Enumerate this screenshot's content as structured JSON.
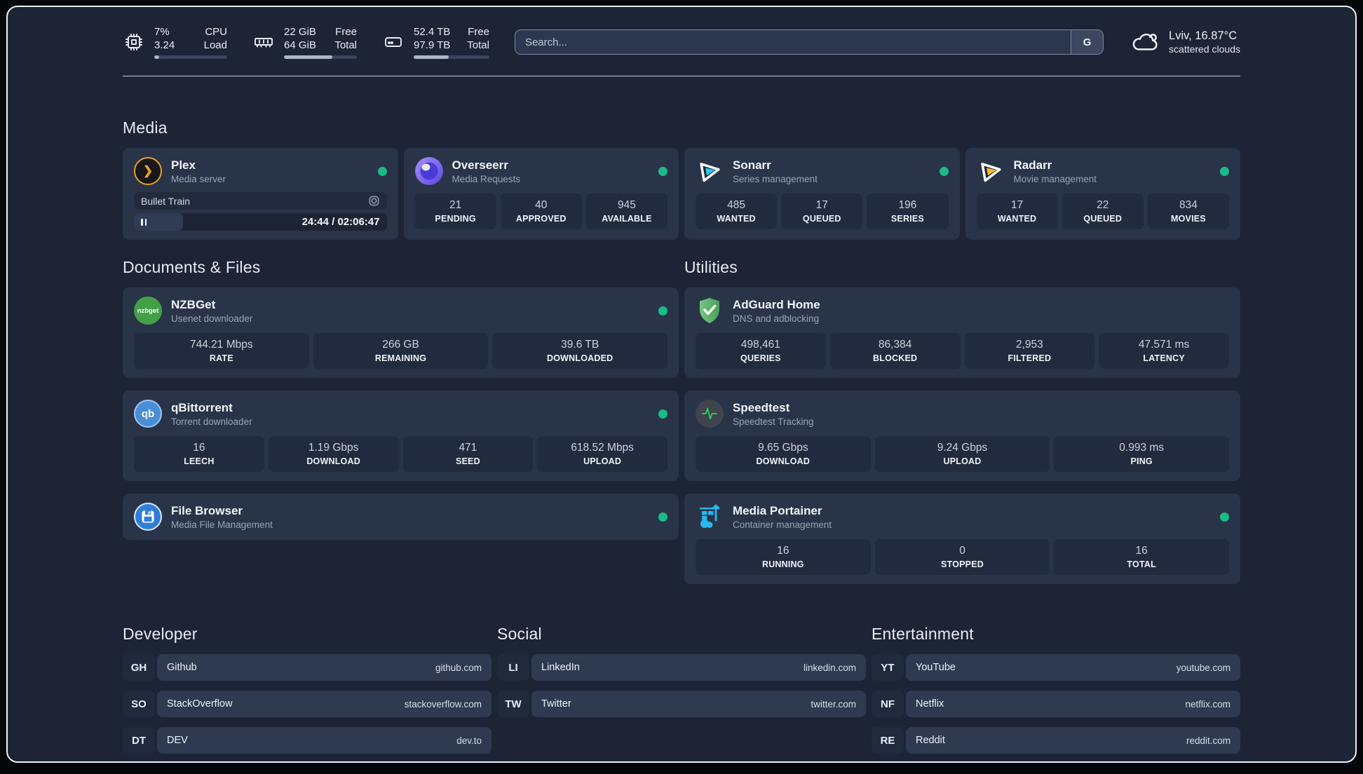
{
  "header": {
    "cpu": {
      "value_top": "7%",
      "value_bottom": "3.24",
      "label_top": "CPU",
      "label_bottom": "Load",
      "progress_pct": 7
    },
    "memory": {
      "value_top": "22 GiB",
      "value_bottom": "64 GiB",
      "label_top": "Free",
      "label_bottom": "Total",
      "progress_pct": 66
    },
    "storage": {
      "value_top": "52.4 TB",
      "value_bottom": "97.9 TB",
      "label_top": "Free",
      "label_bottom": "Total",
      "progress_pct": 46
    },
    "search": {
      "placeholder": "Search...",
      "provider_button": "G"
    },
    "weather": {
      "location": "Lviv, 16.87°C",
      "condition": "scattered clouds"
    }
  },
  "media": {
    "title": "Media",
    "plex": {
      "title": "Plex",
      "subtitle": "Media server",
      "status": "online",
      "now_playing": {
        "track": "Bullet Train",
        "time": "24:44 / 02:06:47",
        "progress_pct": 19.5
      }
    },
    "overseerr": {
      "title": "Overseerr",
      "subtitle": "Media Requests",
      "status": "online",
      "stats": [
        {
          "value": "21",
          "label": "PENDING"
        },
        {
          "value": "40",
          "label": "APPROVED"
        },
        {
          "value": "945",
          "label": "AVAILABLE"
        }
      ]
    },
    "sonarr": {
      "title": "Sonarr",
      "subtitle": "Series management",
      "status": "online",
      "stats": [
        {
          "value": "485",
          "label": "WANTED"
        },
        {
          "value": "17",
          "label": "QUEUED"
        },
        {
          "value": "196",
          "label": "SERIES"
        }
      ]
    },
    "radarr": {
      "title": "Radarr",
      "subtitle": "Movie management",
      "status": "online",
      "stats": [
        {
          "value": "17",
          "label": "WANTED"
        },
        {
          "value": "22",
          "label": "QUEUED"
        },
        {
          "value": "834",
          "label": "MOVIES"
        }
      ]
    }
  },
  "documents": {
    "title": "Documents & Files",
    "nzbget": {
      "title": "NZBGet",
      "subtitle": "Usenet downloader",
      "status": "online",
      "icon_text": "nzbget",
      "stats": [
        {
          "value": "744.21 Mbps",
          "label": "RATE"
        },
        {
          "value": "266 GB",
          "label": "REMAINING"
        },
        {
          "value": "39.6 TB",
          "label": "DOWNLOADED"
        }
      ]
    },
    "qbittorrent": {
      "title": "qBittorrent",
      "subtitle": "Torrent downloader",
      "status": "online",
      "icon_text": "qb",
      "stats": [
        {
          "value": "16",
          "label": "LEECH"
        },
        {
          "value": "1.19 Gbps",
          "label": "DOWNLOAD"
        },
        {
          "value": "471",
          "label": "SEED"
        },
        {
          "value": "618.52 Mbps",
          "label": "UPLOAD"
        }
      ]
    },
    "filebrowser": {
      "title": "File Browser",
      "subtitle": "Media File Management",
      "status": "online"
    }
  },
  "utilities": {
    "title": "Utilities",
    "adguard": {
      "title": "AdGuard Home",
      "subtitle": "DNS and adblocking",
      "stats": [
        {
          "value": "498,461",
          "label": "QUERIES"
        },
        {
          "value": "86,384",
          "label": "BLOCKED"
        },
        {
          "value": "2,953",
          "label": "FILTERED"
        },
        {
          "value": "47.571 ms",
          "label": "LATENCY"
        }
      ]
    },
    "speedtest": {
      "title": "Speedtest",
      "subtitle": "Speedtest Tracking",
      "stats": [
        {
          "value": "9.65 Gbps",
          "label": "DOWNLOAD"
        },
        {
          "value": "9.24 Gbps",
          "label": "UPLOAD"
        },
        {
          "value": "0.993 ms",
          "label": "PING"
        }
      ]
    },
    "portainer": {
      "title": "Media Portainer",
      "subtitle": "Container management",
      "status": "online",
      "stats": [
        {
          "value": "16",
          "label": "RUNNING"
        },
        {
          "value": "0",
          "label": "STOPPED"
        },
        {
          "value": "16",
          "label": "TOTAL"
        }
      ]
    }
  },
  "bookmarks": {
    "developer": {
      "title": "Developer",
      "links": [
        {
          "abbr": "GH",
          "name": "Github",
          "url": "github.com"
        },
        {
          "abbr": "SO",
          "name": "StackOverflow",
          "url": "stackoverflow.com"
        },
        {
          "abbr": "DT",
          "name": "DEV",
          "url": "dev.to"
        }
      ]
    },
    "social": {
      "title": "Social",
      "links": [
        {
          "abbr": "LI",
          "name": "LinkedIn",
          "url": "linkedin.com"
        },
        {
          "abbr": "TW",
          "name": "Twitter",
          "url": "twitter.com"
        }
      ]
    },
    "entertainment": {
      "title": "Entertainment",
      "links": [
        {
          "abbr": "YT",
          "name": "YouTube",
          "url": "youtube.com"
        },
        {
          "abbr": "NF",
          "name": "Netflix",
          "url": "netflix.com"
        },
        {
          "abbr": "RE",
          "name": "Reddit",
          "url": "reddit.com"
        }
      ]
    }
  },
  "colors": {
    "status_online": "#1abc86",
    "plex": "#e8a124",
    "overseerr": "#6d5ce8",
    "sonarr": "#2bc8f5",
    "radarr": "#ffb932",
    "nzbget": "#43a047",
    "qbittorrent": "#4a8ed8",
    "filebrowser": "#2f7fd9",
    "adguard": "#5aa963",
    "speedtest_pulse": "#31d158",
    "portainer": "#28b9eb"
  }
}
